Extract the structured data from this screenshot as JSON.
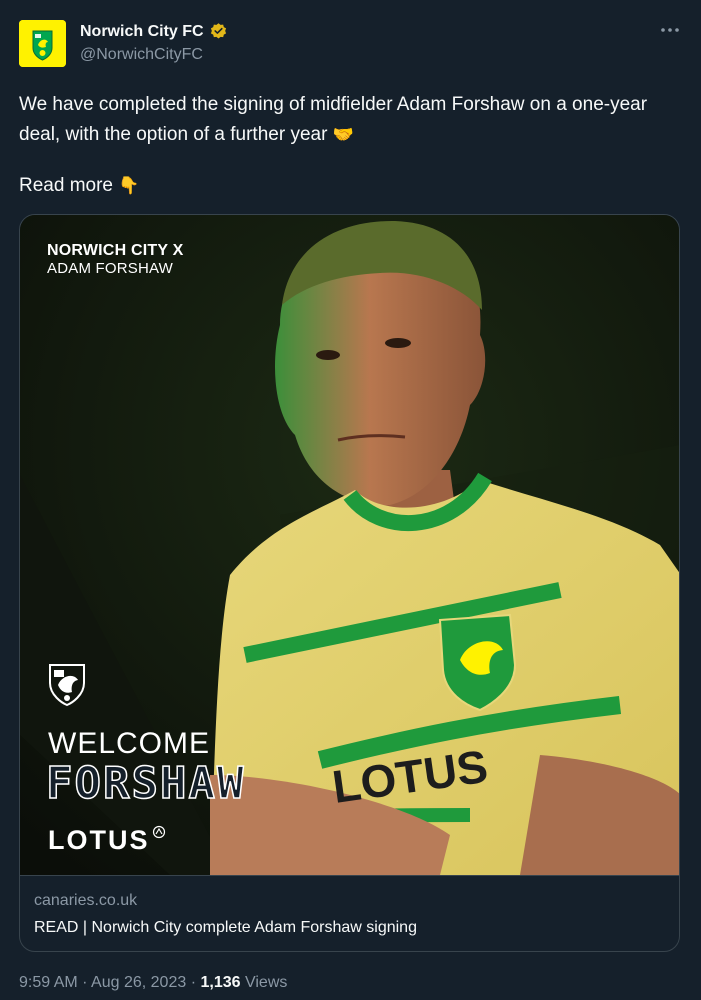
{
  "author": {
    "name": "Norwich City FC",
    "handle": "@NorwichCityFC",
    "verified_icon": "gold-check-badge-icon",
    "more_icon": "more-options-icon"
  },
  "tweet": {
    "text": "We have completed the signing of midfielder Adam Forshaw on a one-year deal, with the option of a further year",
    "text_emoji": "🤝",
    "read_more": "Read more",
    "read_more_emoji": "👇"
  },
  "card": {
    "image_overlay": {
      "line1": "NORWICH CITY X",
      "line2": "ADAM FORSHAW",
      "welcome": "WELCOME",
      "player": "FORSHAW",
      "sponsor": "LOTUS",
      "shirt_sponsor": "LOTUS"
    },
    "domain": "canaries.co.uk",
    "title": "READ | Norwich City complete Adam Forshaw signing"
  },
  "meta": {
    "time": "9:59 AM",
    "separator": "·",
    "date": "Aug 26, 2023",
    "views_count": "1,136",
    "views_label": "Views"
  },
  "colors": {
    "background": "#15202b",
    "text": "#f7f9f9",
    "secondary": "#8b98a5",
    "border": "#38444d",
    "brand_yellow": "#fff200",
    "brand_green": "#00a650"
  }
}
